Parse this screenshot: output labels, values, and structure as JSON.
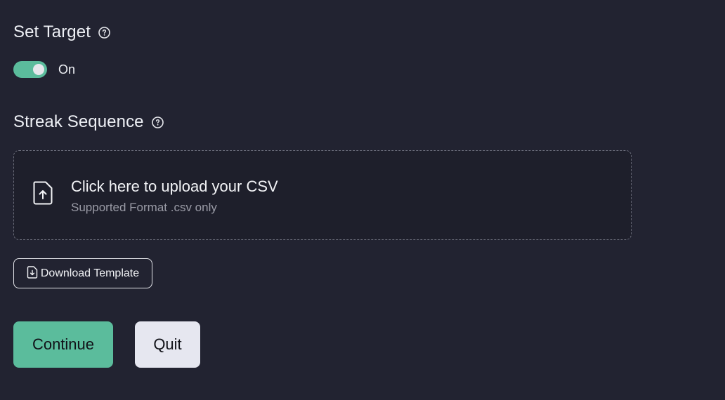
{
  "set_target": {
    "heading": "Set Target",
    "toggle": {
      "state": "on",
      "label": "On"
    }
  },
  "streak_sequence": {
    "heading": "Streak Sequence",
    "upload": {
      "title": "Click here to upload your CSV",
      "subtitle": "Supported Format .csv only"
    },
    "download_template_label": "Download Template"
  },
  "actions": {
    "continue_label": "Continue",
    "quit_label": "Quit"
  },
  "colors": {
    "background": "#222331",
    "accent": "#5bbc9c",
    "secondary_button": "#e6e7f0",
    "muted_text": "#9a9ba6"
  },
  "icons": {
    "help": "question-circle-icon",
    "upload": "file-upload-icon",
    "download": "file-download-icon"
  }
}
